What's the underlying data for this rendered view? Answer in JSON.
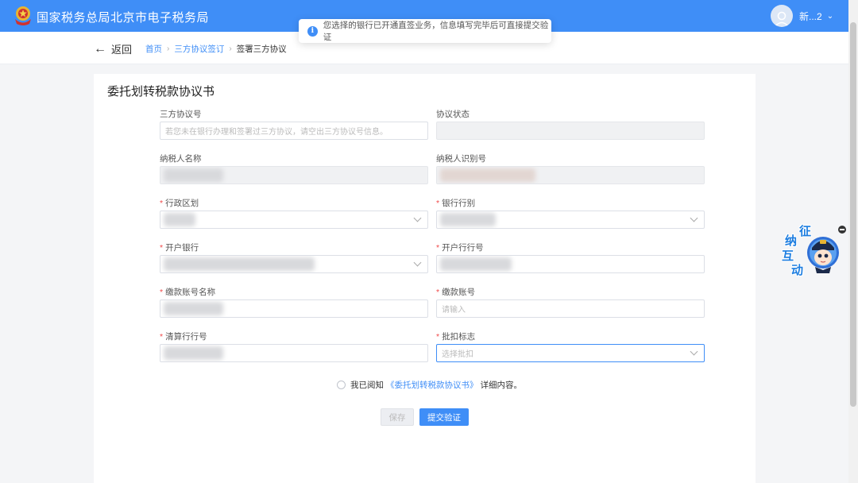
{
  "header": {
    "site_title": "国家税务总局北京市电子税务局",
    "user_name": "新...2",
    "user_caret": "⌄"
  },
  "toast": {
    "icon": "info-icon",
    "text": "您选择的银行已开通直签业务，信息填写完毕后可直接提交验证"
  },
  "nav": {
    "back_label": "返回",
    "breadcrumb": [
      "首页",
      "三方协议签订",
      "签署三方协议"
    ],
    "breadcrumb_sep": "›"
  },
  "form": {
    "title": "委托划转税款协议书",
    "fields": {
      "agreement_no": {
        "label": "三方协议号",
        "required": false,
        "placeholder": "若您未在银行办理和签署过三方协议，请空出三方协议号信息。"
      },
      "agreement_status": {
        "label": "协议状态",
        "required": false
      },
      "taxpayer_name": {
        "label": "纳税人名称",
        "required": false
      },
      "taxpayer_id": {
        "label": "纳税人识别号",
        "required": false
      },
      "region": {
        "label": "行政区划",
        "required": true
      },
      "bank_type": {
        "label": "银行行别",
        "required": true
      },
      "open_bank": {
        "label": "开户银行",
        "required": true
      },
      "open_bank_no": {
        "label": "开户行行号",
        "required": true
      },
      "account_name": {
        "label": "缴款账号名称",
        "required": true
      },
      "account_no": {
        "label": "缴款账号",
        "required": true,
        "placeholder": "请输入"
      },
      "clearing_no": {
        "label": "清算行行号",
        "required": true
      },
      "deduct_flag": {
        "label": "批扣标志",
        "required": true,
        "placeholder": "选择批扣"
      }
    },
    "required_mark": "*",
    "agree": {
      "prefix": "我已阅知",
      "link": "《委托划转税款协议书》",
      "suffix": "详细内容。"
    },
    "buttons": {
      "save": "保存",
      "submit": "提交验证"
    }
  },
  "widget": {
    "chars": [
      "征",
      "纳",
      "互",
      "动"
    ]
  }
}
